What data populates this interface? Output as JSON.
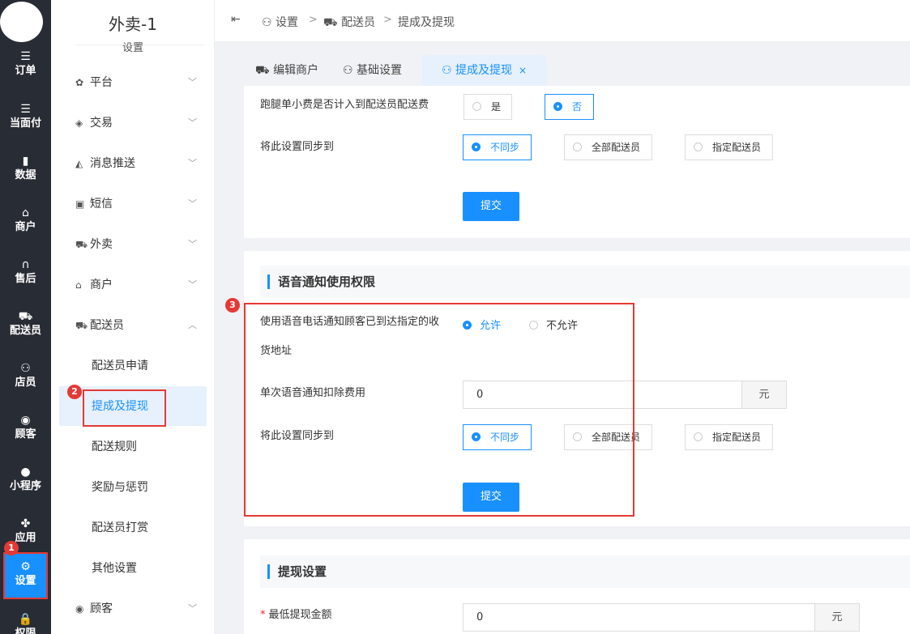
{
  "rail": {
    "items": [
      {
        "label": "订单",
        "icon": "list-icon",
        "glyph": "☰"
      },
      {
        "label": "当面付",
        "icon": "list-icon",
        "glyph": "☰"
      },
      {
        "label": "数据",
        "icon": "bar-chart-icon",
        "glyph": "▮"
      },
      {
        "label": "商户",
        "icon": "shop-icon",
        "glyph": "⌂"
      },
      {
        "label": "售后",
        "icon": "headset-icon",
        "glyph": "∩"
      },
      {
        "label": "配送员",
        "icon": "scooter-icon",
        "glyph": "⛟"
      },
      {
        "label": "店员",
        "icon": "users-icon",
        "glyph": "⚇"
      },
      {
        "label": "顾客",
        "icon": "user-circle-icon",
        "glyph": "◉"
      },
      {
        "label": "小程序",
        "icon": "wechat-icon",
        "glyph": "●"
      },
      {
        "label": "应用",
        "icon": "apps-icon",
        "glyph": "✤"
      },
      {
        "label": "设置",
        "icon": "user-settings-icon",
        "glyph": "⚙"
      },
      {
        "label": "权限",
        "icon": "lock-icon",
        "glyph": "🔒"
      }
    ],
    "active_color": "#1890ff"
  },
  "side": {
    "store_name": "外卖-1",
    "store_sub": "设置",
    "menu": [
      {
        "label": "平台",
        "icon": "gear-icon",
        "glyph": "✿",
        "chev": "﹀"
      },
      {
        "label": "交易",
        "icon": "wallet-icon",
        "glyph": "◈",
        "chev": "﹀"
      },
      {
        "label": "消息推送",
        "icon": "send-icon",
        "glyph": "◭",
        "chev": "﹀"
      },
      {
        "label": "短信",
        "icon": "chat-icon",
        "glyph": "▣",
        "chev": "﹀"
      },
      {
        "label": "外卖",
        "icon": "scooter-icon",
        "glyph": "⛟",
        "chev": "﹀"
      },
      {
        "label": "商户",
        "icon": "shop-icon",
        "glyph": "⌂",
        "chev": "﹀"
      },
      {
        "label": "配送员",
        "icon": "scooter-icon",
        "glyph": "⛟",
        "chev": "︿"
      }
    ],
    "sub": [
      "配送员申请",
      "提成及提现",
      "配送规则",
      "奖励与惩罚",
      "配送员打赏",
      "其他设置"
    ],
    "bottom": {
      "label": "顾客",
      "icon": "user-circle-icon",
      "glyph": "◉",
      "chev": "﹀"
    }
  },
  "header": {
    "fold_glyph": "⇤",
    "crumbs": [
      "设置",
      "配送员",
      "提成及提现"
    ],
    "sep": ">"
  },
  "tabs": [
    {
      "label": "编辑商户",
      "icon": "scooter-icon",
      "glyph": "⛟"
    },
    {
      "label": "基础设置",
      "icon": "user-settings-icon",
      "glyph": "⚇"
    },
    {
      "label": "提成及提现",
      "icon": "user-settings-icon",
      "glyph": "⚇",
      "close": "×"
    }
  ],
  "section1": {
    "q1_label": "跑腿单小费是否计入到配送员配送费",
    "q1_options": [
      "是",
      "否"
    ],
    "q1_selected": "否",
    "sync_label": "将此设置同步到",
    "sync_options": [
      "不同步",
      "全部配送员",
      "指定配送员"
    ],
    "sync_selected": "不同步",
    "submit": "提交"
  },
  "section2": {
    "title": "语音通知使用权限",
    "q_label_line1": "使用语音电话通知顾客已到达指定的收",
    "q_label_line2": "货地址",
    "q_options": [
      "允许",
      "不允许"
    ],
    "q_selected": "允许",
    "fee_label": "单次语音通知扣除费用",
    "fee_value": "0",
    "fee_unit": "元",
    "sync_label": "将此设置同步到",
    "sync_options": [
      "不同步",
      "全部配送员",
      "指定配送员"
    ],
    "sync_selected": "不同步",
    "submit": "提交"
  },
  "section3": {
    "title": "提现设置",
    "min_label": "最低提现金额",
    "min_required": "*",
    "min_value": "0",
    "min_unit": "元"
  },
  "annotations": [
    "1",
    "2",
    "3"
  ]
}
